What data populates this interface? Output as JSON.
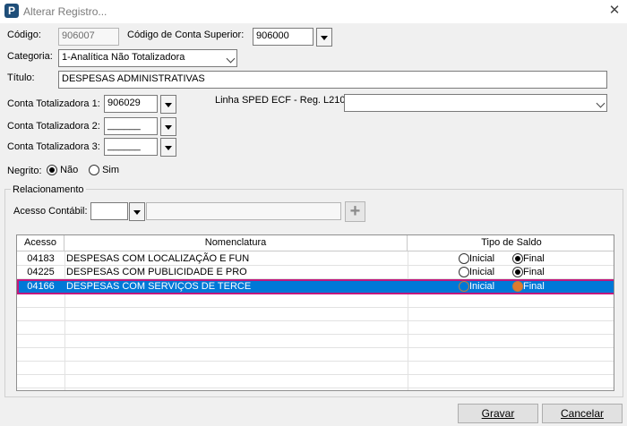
{
  "window": {
    "app_icon": "P",
    "title": "Alterar Registro...",
    "close_glyph": "✕"
  },
  "form": {
    "codigo_label": "Código:",
    "codigo_value": "906007",
    "conta_superior_label": "Código de Conta Superior:",
    "conta_superior_value": "906000",
    "categoria_label": "Categoria:",
    "categoria_value": "1-Analítica Não Totalizadora",
    "titulo_label": "Título:",
    "titulo_value": "DESPESAS ADMINISTRATIVAS",
    "totalizadora1_label": "Conta Totalizadora 1:",
    "totalizadora1_value": "906029",
    "totalizadora2_label": "Conta Totalizadora 2:",
    "totalizadora2_value": "______",
    "totalizadora3_label": "Conta Totalizadora 3:",
    "totalizadora3_value": "______",
    "sped_label": "Linha SPED ECF - Reg. L210:",
    "sped_value": "",
    "negrito_label": "Negrito:",
    "negrito_nao": "Não",
    "negrito_sim": "Sim",
    "negrito_selected": "Não"
  },
  "relacionamento": {
    "legend": "Relacionamento",
    "acesso_label": "Acesso Contábil:",
    "acesso_value": "",
    "add_glyph": "+",
    "columns": [
      "Acesso",
      "Nomenclatura",
      "Tipo de Saldo"
    ],
    "rows": [
      {
        "acesso": "04183",
        "nomenclatura": "DESPESAS COM LOCALIZAÇÃO E FUN",
        "inicial": "Inicial",
        "final": "Final",
        "saldo": "Final"
      },
      {
        "acesso": "04225",
        "nomenclatura": "DESPESAS COM PUBLICIDADE E PRO",
        "inicial": "Inicial",
        "final": "Final",
        "saldo": "Final"
      },
      {
        "acesso": "04166",
        "nomenclatura": "DESPESAS COM SERVIÇOS DE TERCE",
        "inicial": "Inicial",
        "final": "Final",
        "saldo": "Final",
        "selected": true
      }
    ]
  },
  "footer": {
    "gravar_label": "Gravar",
    "cancelar_label": "Cancelar"
  },
  "colors": {
    "selection": "#0078d7",
    "selection_outline": "#c2187c"
  }
}
